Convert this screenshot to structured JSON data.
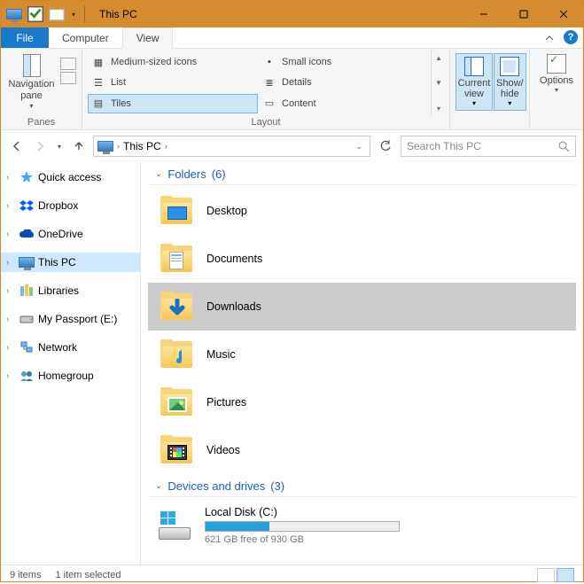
{
  "window": {
    "title": "This PC"
  },
  "tabs": {
    "file": "File",
    "computer": "Computer",
    "view": "View"
  },
  "ribbon": {
    "panes": {
      "label": "Panes",
      "navigation": "Navigation\npane"
    },
    "layout": {
      "label": "Layout",
      "items": {
        "medium": "Medium-sized icons",
        "small": "Small icons",
        "list": "List",
        "details": "Details",
        "tiles": "Tiles",
        "content": "Content"
      }
    },
    "currentview": {
      "label": "Current\nview"
    },
    "showhide": {
      "label": "Show/\nhide"
    },
    "options": {
      "label": "Options"
    }
  },
  "address": {
    "location": "This PC"
  },
  "search": {
    "placeholder": "Search This PC"
  },
  "sidebar": {
    "quickaccess": "Quick access",
    "dropbox": "Dropbox",
    "onedrive": "OneDrive",
    "thispc": "This PC",
    "libraries": "Libraries",
    "passport": "My Passport (E:)",
    "network": "Network",
    "homegroup": "Homegroup"
  },
  "groups": {
    "folders": {
      "name": "Folders",
      "count": "(6)"
    },
    "drives": {
      "name": "Devices and drives",
      "count": "(3)"
    }
  },
  "folders": {
    "desktop": "Desktop",
    "documents": "Documents",
    "downloads": "Downloads",
    "music": "Music",
    "pictures": "Pictures",
    "videos": "Videos"
  },
  "drives": {
    "c": {
      "name": "Local Disk (C:)",
      "free": "621 GB free of 930 GB",
      "used_pct": 33
    }
  },
  "status": {
    "items": "9 items",
    "selected": "1 item selected"
  }
}
